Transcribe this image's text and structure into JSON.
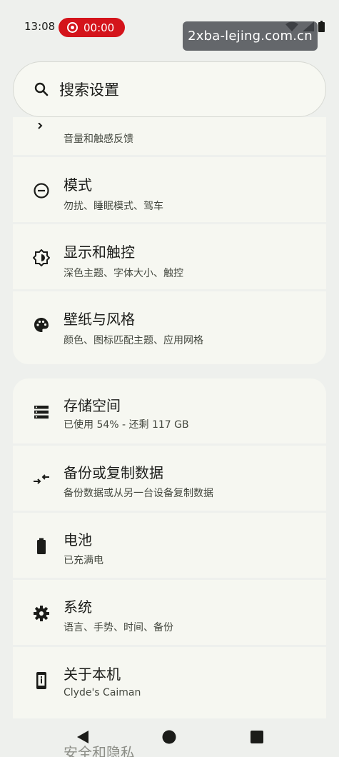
{
  "status_bar": {
    "time": "13:08",
    "recording": "00:00",
    "recording_color": "#d4141b"
  },
  "watermark": "2xba-lejing.com.cn",
  "search": {
    "placeholder": "搜索设置",
    "icon": "search-icon"
  },
  "group1": {
    "items": [
      {
        "title": "",
        "subtitle": "音量和触感反馈",
        "icon": "volume-icon"
      },
      {
        "title": "模式",
        "subtitle": "勿扰、睡眠模式、驾车",
        "icon": "do-not-disturb-icon"
      },
      {
        "title": "显示和触控",
        "subtitle": "深色主题、字体大小、触控",
        "icon": "brightness-icon"
      },
      {
        "title": "壁纸与风格",
        "subtitle": "颜色、图标匹配主题、应用网格",
        "icon": "palette-icon"
      }
    ]
  },
  "group2": {
    "items": [
      {
        "title": "存储空间",
        "subtitle": "已使用 54% - 还剩 117 GB",
        "icon": "storage-icon"
      },
      {
        "title": "备份或复制数据",
        "subtitle": "备份数据或从另一台设备复制数据",
        "icon": "transfer-icon"
      },
      {
        "title": "电池",
        "subtitle": "已充满电",
        "icon": "battery-icon"
      },
      {
        "title": "系统",
        "subtitle": "语言、手势、时间、备份",
        "icon": "gear-icon"
      },
      {
        "title": "关于本机",
        "subtitle": "Clyde's Caiman",
        "icon": "phone-info-icon"
      }
    ]
  },
  "peek_item": "安全和隐私",
  "navbar": {
    "back": "back-icon",
    "home": "home-icon",
    "recents": "recents-icon"
  }
}
